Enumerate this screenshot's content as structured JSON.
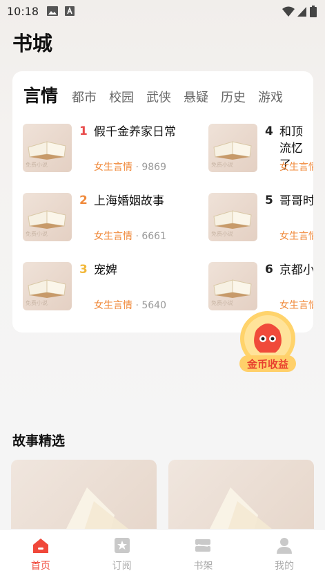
{
  "status_bar": {
    "time": "10:18"
  },
  "page_title": "书城",
  "category_tabs": [
    "言情",
    "都市",
    "校园",
    "武侠",
    "悬疑",
    "历史",
    "游戏"
  ],
  "books": [
    {
      "rank": "1",
      "title": "假千金养家日常",
      "category": "女生言情",
      "count": "9869"
    },
    {
      "rank": "2",
      "title": "上海婚姻故事",
      "category": "女生言情",
      "count": "6661"
    },
    {
      "rank": "3",
      "title": "宠婢",
      "category": "女生言情",
      "count": "5640"
    },
    {
      "rank": "4",
      "title": "和顶流忆了",
      "category": "女生言情",
      "count": ""
    },
    {
      "rank": "5",
      "title": "哥哥时",
      "category": "女生言情",
      "count": ""
    },
    {
      "rank": "6",
      "title": "京都小",
      "category": "女生言情",
      "count": ""
    }
  ],
  "cover_text": "免费小说",
  "coin_badge": {
    "label": "金币收益"
  },
  "section": {
    "title": "故事精选"
  },
  "bottom_nav": [
    {
      "label": "首页",
      "icon": "home-icon",
      "active": true
    },
    {
      "label": "订阅",
      "icon": "star-bookmark-icon",
      "active": false
    },
    {
      "label": "书架",
      "icon": "bookshelf-icon",
      "active": false
    },
    {
      "label": "我的",
      "icon": "user-icon",
      "active": false
    }
  ],
  "colors": {
    "accent": "#f0483a",
    "category": "#f0893a",
    "rank1": "#e84a4a",
    "rank2": "#f08a3c",
    "rank3": "#f2b83a"
  }
}
